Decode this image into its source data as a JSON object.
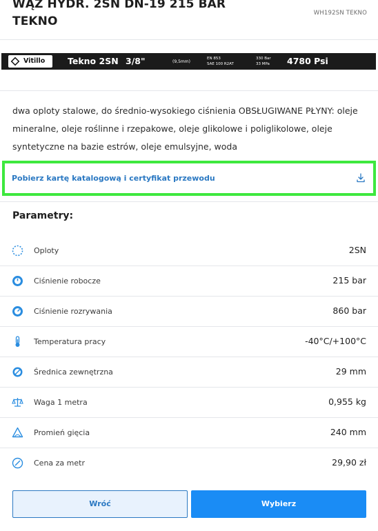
{
  "product": {
    "title": "WĄŻ HYDR. 2SN DN-19 215 BAR TEKNO",
    "sku": "WH192SN TEKNO"
  },
  "hose_banner": {
    "brand": "Vitillo",
    "model": "Tekno 2SN",
    "size": "3/8\"",
    "size_mm": "(9,5mm)",
    "standard_line1": "EN 853",
    "standard_line2": "SAE 100 R2AT",
    "pressure_line1": "330 Bar",
    "pressure_line2": "33 MPa",
    "psi": "4780 Psi"
  },
  "description": "dwa oploty stalowe, do średnio-wysokiego ciśnienia OBSŁUGIWANE PŁYNY: oleje mineralne, oleje roślinne i rzepakowe, oleje glikolowe i poliglikolowe, oleje syntetyczne na bazie estrów, oleje emulsyjne, woda",
  "download": {
    "label": "Pobierz kartę katalogową i certyfikat przewodu",
    "icon": "download-icon"
  },
  "params": {
    "title": "Parametry:",
    "rows": [
      {
        "icon": "braid-icon",
        "label": "Oploty",
        "value": "2SN"
      },
      {
        "icon": "pressure-gauge-icon",
        "label": "Ciśnienie robocze",
        "value": "215 bar"
      },
      {
        "icon": "burst-gauge-icon",
        "label": "Ciśnienie rozrywania",
        "value": "860 bar"
      },
      {
        "icon": "thermometer-icon",
        "label": "Temperatura pracy",
        "value": "-40°C/+100°C"
      },
      {
        "icon": "diameter-icon",
        "label": "Średnica zewnętrzna",
        "value": "29 mm"
      },
      {
        "icon": "scale-icon",
        "label": "Waga 1 metra",
        "value": "0,955 kg"
      },
      {
        "icon": "bend-radius-icon",
        "label": "Promień gięcia",
        "value": "240 mm"
      },
      {
        "icon": "price-icon",
        "label": "Cena za metr",
        "value": "29,90 zł"
      }
    ]
  },
  "buttons": {
    "back": "Wróć",
    "select": "Wybierz"
  },
  "colors": {
    "accent": "#1a8cf5",
    "link": "#2a78c2",
    "highlight": "#3ee83e"
  }
}
